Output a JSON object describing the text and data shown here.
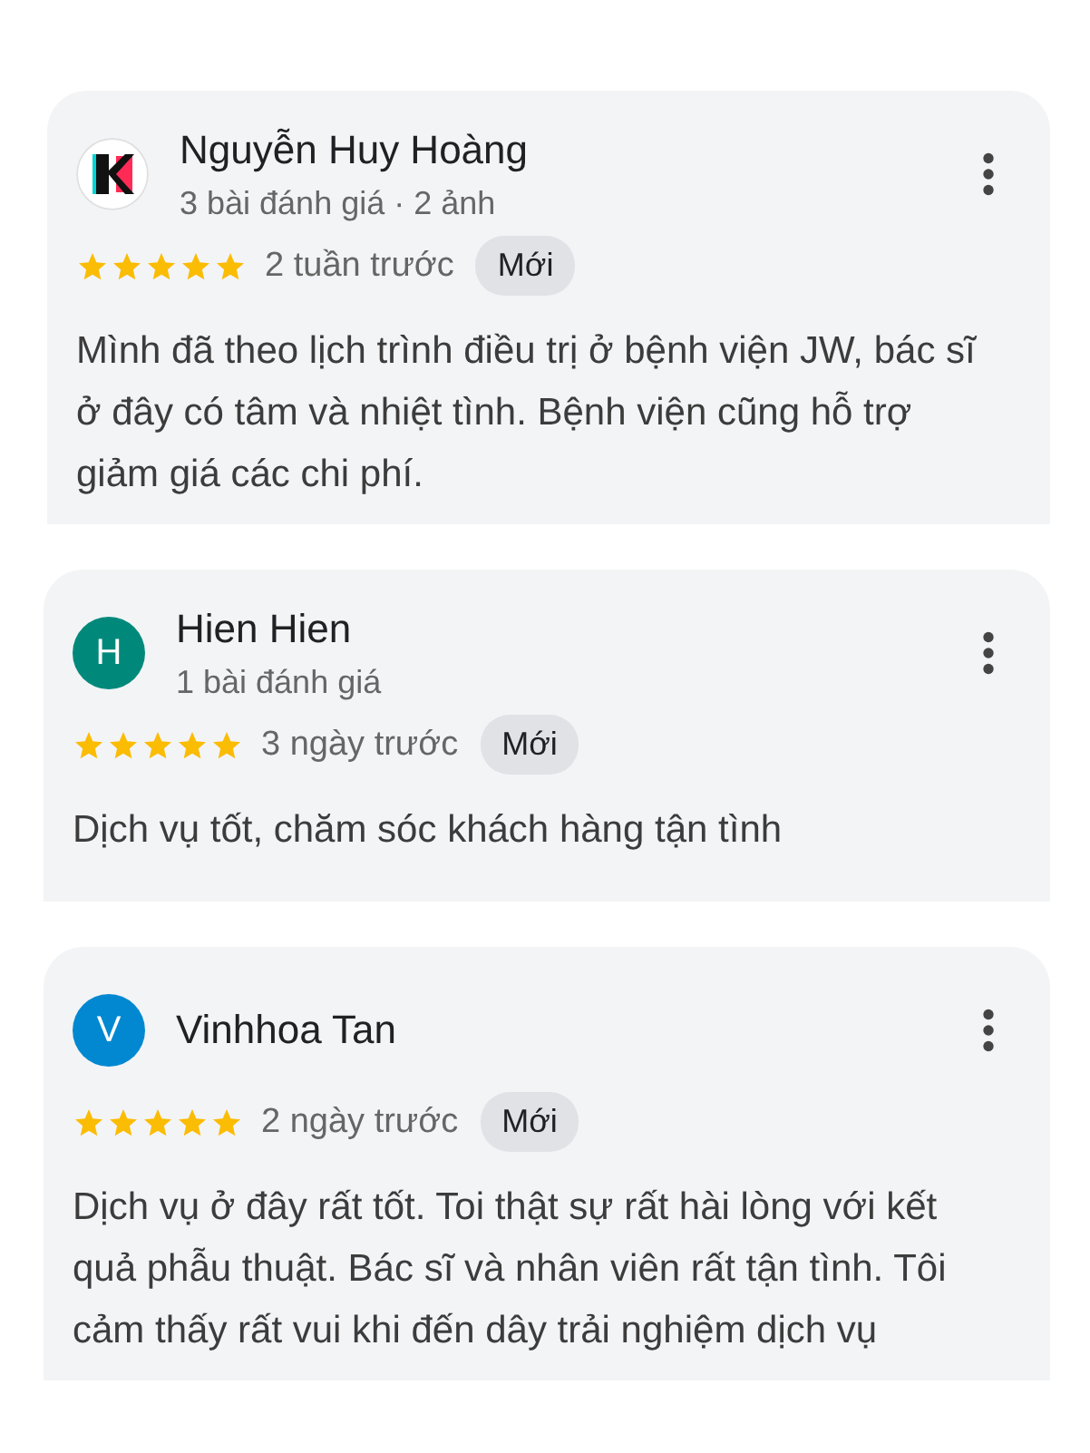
{
  "reviews": [
    {
      "name": "Nguyễn Huy Hoàng",
      "meta": "3 bài đánh giá · 2 ảnh",
      "stars": 5,
      "time": "2 tuần trước",
      "badge": "Mới",
      "text": "Mình đã theo lịch trình điều trị ở bệnh viện JW, bác sĩ ở đây có tâm và nhiệt tình. Bệnh viện cũng hỗ trợ giảm giá các chi phí."
    },
    {
      "name": "Hien Hien",
      "avatar": {
        "kind": "letter",
        "letter": "H",
        "color": "#00897b"
      },
      "meta": "1 bài đánh giá",
      "stars": 5,
      "time": "3 ngày trước",
      "badge": "Mới",
      "text": "Dịch vụ tốt, chăm sóc khách hàng tận tình"
    },
    {
      "name": "Vinhhoa Tan",
      "avatar": {
        "kind": "letter",
        "letter": "V",
        "color": "#0288d1"
      },
      "stars": 5,
      "time": "2 ngày trước",
      "badge": "Mới",
      "text": "Dịch vụ ở đây rất tốt. Toi thật sự rất hài lòng với kết quả phẫu thuật. Bác sĩ và nhân viên rất tận tình. Tôi cảm thấy rất vui khi đến dây trải nghiệm dịch vụ"
    }
  ]
}
